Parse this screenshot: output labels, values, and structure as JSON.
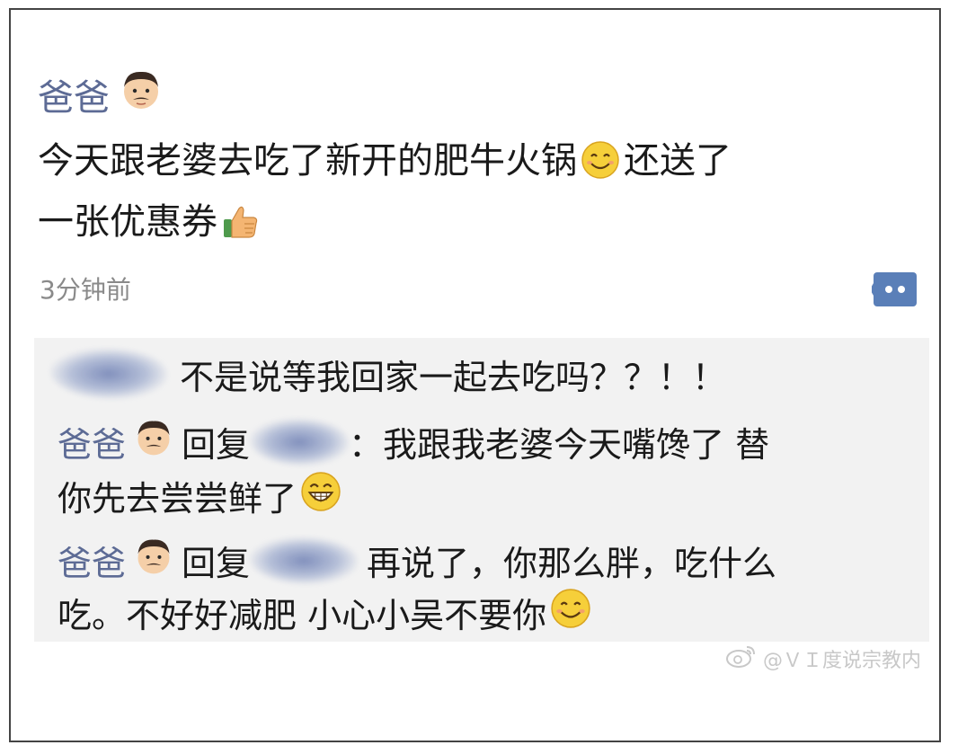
{
  "post": {
    "author": "爸爸",
    "author_emoji": "man-face-emoji",
    "text_part1": "今天跟老婆去吃了新开的肥牛火锅",
    "text_part2": "还送了",
    "text_part3": "一张优惠券",
    "timestamp": "3分钟前"
  },
  "comments": [
    {
      "type": "comment",
      "text": "不是说等我回家一起去吃吗？？！！"
    },
    {
      "type": "reply",
      "author": "爸爸",
      "reply_word": "回复",
      "line1": "：我跟我老婆今天嘴馋了 替",
      "line2": "你先去尝尝鲜了"
    },
    {
      "type": "reply",
      "author": "爸爸",
      "reply_word": "回复",
      "line1": "再说了，你那么胖，吃什么",
      "line2": "吃。不好好减肥 小心小吴不要你"
    }
  ],
  "watermark": {
    "text": "@ＶＩ度说宗教内"
  },
  "colors": {
    "name": "#5d6b95",
    "text": "#1a1a1a",
    "meta": "#8a8a8a",
    "comment_bg": "#f2f2f2",
    "accent_button": "#5a7fb8"
  }
}
